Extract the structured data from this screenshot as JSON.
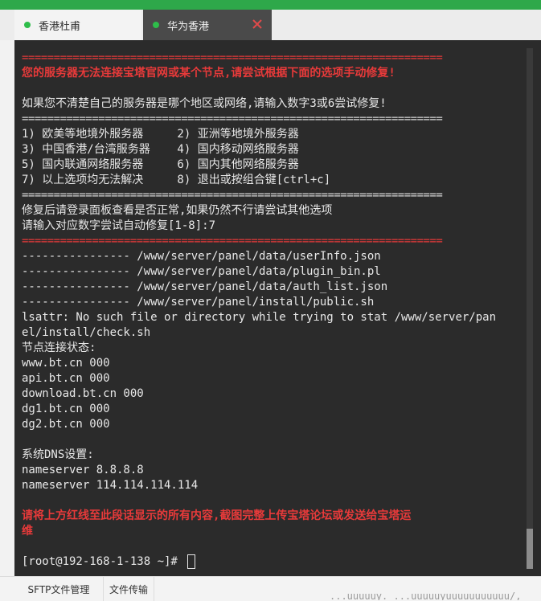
{
  "tabs": [
    {
      "label": "香港杜甫",
      "active": false
    },
    {
      "label": "华为香港",
      "active": true
    }
  ],
  "terminal": {
    "lines": [
      {
        "text": "==================================================================",
        "style": "sepred"
      },
      {
        "text": "您的服务器无法连接宝塔官网或某个节点,请尝试根据下面的选项手动修复!",
        "style": "red"
      },
      {
        "text": "",
        "style": ""
      },
      {
        "text": "如果您不清楚自己的服务器是哪个地区或网络,请输入数字3或6尝试修复!",
        "style": ""
      },
      {
        "text": "==================================================================",
        "style": "sep"
      },
      {
        "text": "1) 欧美等地境外服务器     2) 亚洲等地境外服务器",
        "style": ""
      },
      {
        "text": "3) 中国香港/台湾服务器    4) 国内移动网络服务器",
        "style": ""
      },
      {
        "text": "5) 国内联通网络服务器     6) 国内其他网络服务器",
        "style": ""
      },
      {
        "text": "7) 以上选项均无法解决     8) 退出或按组合键[ctrl+c]",
        "style": ""
      },
      {
        "text": "==================================================================",
        "style": "sep"
      },
      {
        "text": "修复后请登录面板查看是否正常,如果仍然不行请尝试其他选项",
        "style": ""
      },
      {
        "text": "请输入对应数字尝试自动修复[1-8]:7",
        "style": ""
      },
      {
        "text": "==================================================================",
        "style": "sepred"
      },
      {
        "text": "---------------- /www/server/panel/data/userInfo.json",
        "style": ""
      },
      {
        "text": "---------------- /www/server/panel/data/plugin_bin.pl",
        "style": ""
      },
      {
        "text": "---------------- /www/server/panel/data/auth_list.json",
        "style": ""
      },
      {
        "text": "---------------- /www/server/panel/install/public.sh",
        "style": ""
      },
      {
        "text": "lsattr: No such file or directory while trying to stat /www/server/pan",
        "style": ""
      },
      {
        "text": "el/install/check.sh",
        "style": ""
      },
      {
        "text": "节点连接状态:",
        "style": ""
      },
      {
        "text": "www.bt.cn 000",
        "style": ""
      },
      {
        "text": "api.bt.cn 000",
        "style": ""
      },
      {
        "text": "download.bt.cn 000",
        "style": ""
      },
      {
        "text": "dg1.bt.cn 000",
        "style": ""
      },
      {
        "text": "dg2.bt.cn 000",
        "style": ""
      },
      {
        "text": "",
        "style": ""
      },
      {
        "text": "系统DNS设置:",
        "style": ""
      },
      {
        "text": "nameserver 8.8.8.8",
        "style": ""
      },
      {
        "text": "nameserver 114.114.114.114",
        "style": ""
      },
      {
        "text": "",
        "style": ""
      },
      {
        "text": "请将上方红线至此段话显示的所有内容,截图完整上传宝塔论坛或发送给宝塔运",
        "style": "red"
      },
      {
        "text": "维",
        "style": "red"
      },
      {
        "text": "",
        "style": ""
      }
    ],
    "prompt": "[root@192-168-1-138 ~]# "
  },
  "bottom_tabs": [
    {
      "label": "SFTP文件管理"
    },
    {
      "label": "文件传输"
    }
  ],
  "bottom_overflow_text": "...uuuuuy. ...uuuuuyuuuuuuuuuuu/,"
}
